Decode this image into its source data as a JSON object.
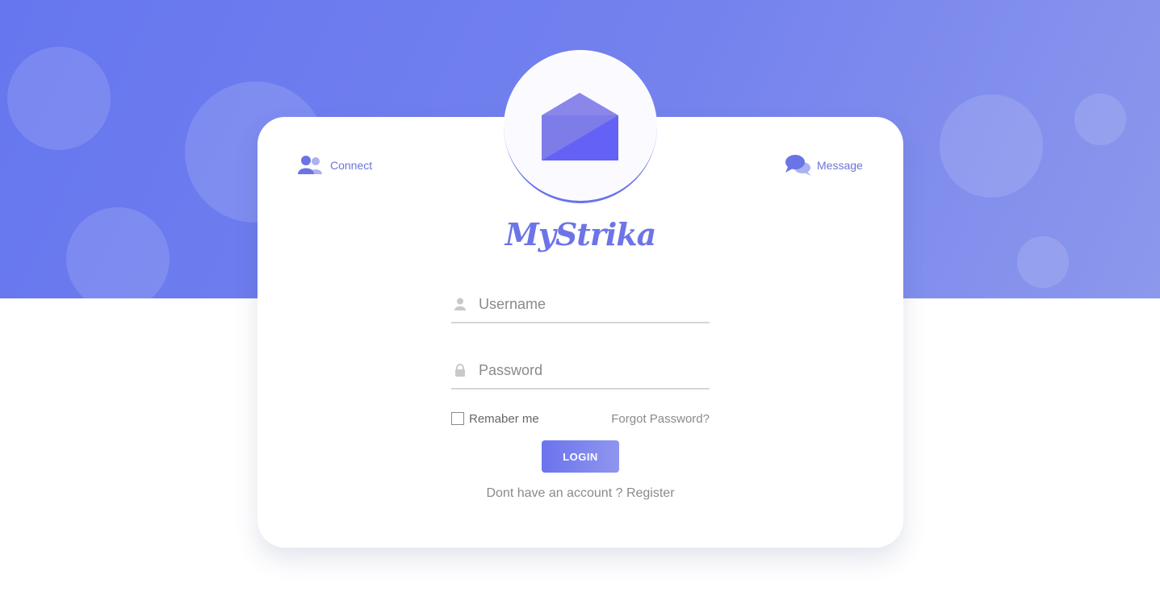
{
  "header": {
    "connect_label": "Connect",
    "message_label": "Message"
  },
  "brand": {
    "name": "MyStrika"
  },
  "form": {
    "username_placeholder": "Username",
    "password_placeholder": "Password",
    "remember_label": "Remaber me",
    "forgot_label": "Forgot Password?",
    "login_label": "LOGIN",
    "register_prompt": "Dont have an account ?",
    "register_link": "Register"
  },
  "icons": {
    "connect": "users-icon",
    "message": "chat-bubbles-icon",
    "logo": "envelope-icon",
    "username": "user-icon",
    "password": "lock-icon"
  },
  "colors": {
    "accent": "#6b73ee",
    "hero_start": "#6676ee",
    "hero_end": "#8c98ec",
    "text_muted": "#8a8a8a"
  }
}
